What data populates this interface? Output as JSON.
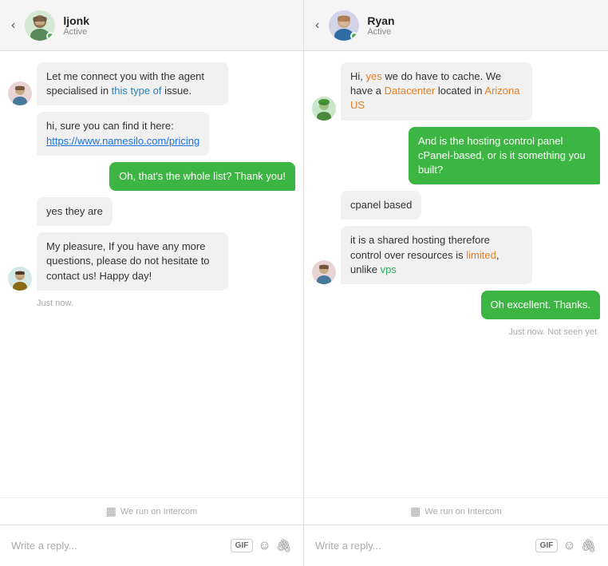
{
  "panel1": {
    "header": {
      "name": "ljonk",
      "status": "Active",
      "back_label": "‹"
    },
    "messages": [
      {
        "id": "m1",
        "type": "agent",
        "has_avatar": true,
        "avatar_class": "av-agent1",
        "text": "Let me connect you with the agent specialised in this type of issue."
      },
      {
        "id": "m2",
        "type": "agent",
        "has_avatar": false,
        "text": "hi, sure you can find it here:",
        "link_text": "https://www.namesilo.com/pricing",
        "link_url": "#"
      },
      {
        "id": "m3",
        "type": "user",
        "has_avatar": false,
        "text": "Oh, that's the whole list? Thank you!"
      },
      {
        "id": "m4",
        "type": "agent",
        "has_avatar": false,
        "text": "yes they are"
      },
      {
        "id": "m5",
        "type": "agent",
        "has_avatar": true,
        "avatar_class": "av-agent2",
        "text": "My pleasure, If you have any more questions, please do not hesitate to contact us! Happy day!"
      }
    ],
    "timestamp": "Just now.",
    "footer": "We run on Intercom",
    "reply_placeholder": "Write a reply...",
    "gif_label": "GIF"
  },
  "panel2": {
    "header": {
      "name": "Ryan",
      "status": "Active",
      "back_label": "‹"
    },
    "messages": [
      {
        "id": "r1",
        "type": "agent",
        "has_avatar": true,
        "avatar_class": "av-ryan",
        "text_parts": [
          {
            "text": "Hi, yes we do have to cache. We have a Datacenter located in Arizona US",
            "highlights": [
              {
                "word": "yes",
                "color": "orange"
              },
              {
                "word": "Datacenter",
                "color": "orange"
              },
              {
                "word": "Arizona US",
                "color": "orange"
              }
            ]
          }
        ],
        "raw_html": "Hi, <span style='color:#e67e22'>yes</span> we do have to cache. We have a <span style='color:#e67e22'>Datacenter</span> located in <span style='color:#e67e22'>Arizona US</span>"
      },
      {
        "id": "r2",
        "type": "user",
        "has_avatar": false,
        "text": "And is the hosting control panel cPanel-based, or is it something you built?"
      },
      {
        "id": "r3",
        "type": "agent",
        "has_avatar": false,
        "text": "cpanel based"
      },
      {
        "id": "r4",
        "type": "agent",
        "has_avatar": true,
        "avatar_class": "av-agent1",
        "raw_html": "it is a shared hosting therefore control over resources is <span style='color:#e67e22'>limited</span>, unlike <span style='color:#27ae60'>vps</span>"
      },
      {
        "id": "r5",
        "type": "user",
        "has_avatar": false,
        "text": "Oh excellent. Thanks."
      }
    ],
    "timestamp": "Just now. Not seen yet",
    "footer": "We run on Intercom",
    "reply_placeholder": "Write a reply...",
    "gif_label": "GIF"
  },
  "icons": {
    "intercom": "▦",
    "emoji": "☺",
    "attach": "🖇",
    "gif": "GIF"
  }
}
